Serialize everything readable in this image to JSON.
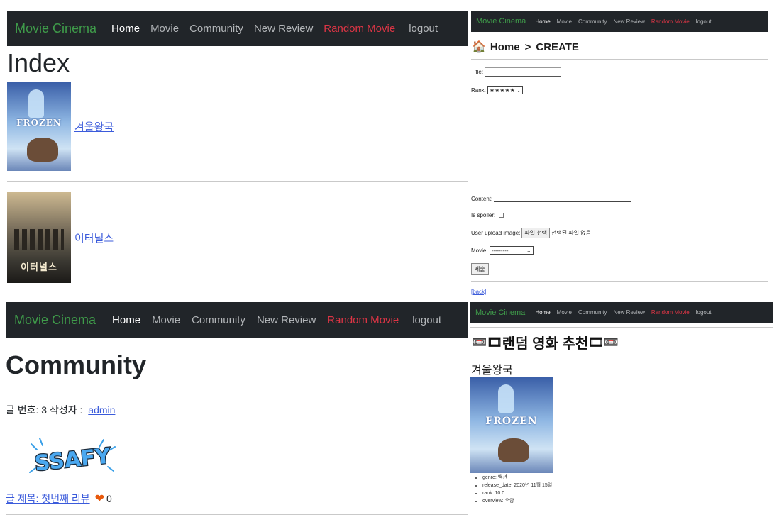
{
  "nav": {
    "brand": "Movie Cinema",
    "home": "Home",
    "movie": "Movie",
    "community": "Community",
    "new_review": "New Review",
    "random_movie": "Random Movie",
    "logout": "logout"
  },
  "index_page": {
    "title": "Index",
    "movies": [
      {
        "title": "겨울왕국",
        "poster_text": "FROZEN"
      },
      {
        "title": "이터널스",
        "poster_text": "이터널스"
      }
    ]
  },
  "create_page": {
    "breadcrumb": {
      "home_icon": "🏠",
      "home": "Home",
      "separator": ">",
      "current": "CREATE"
    },
    "labels": {
      "title": "Title:",
      "rank": "Rank:",
      "content": "Content:",
      "is_spoiler": "Is spoiler:",
      "user_upload_image": "User upload image:",
      "movie": "Movie:"
    },
    "rank_value": "★★★★★",
    "file_button": "파일 선택",
    "file_status": "선택된 파일 없음",
    "movie_select_value": "---------",
    "submit_button": "제출",
    "back_link": "[back]"
  },
  "community_page": {
    "title": "Community",
    "post_number_label": "글 번호: 3 작성자 :",
    "author": "admin",
    "logo_text": "SSAFY",
    "post_title_link": "글 제목: 첫번째 리뷰",
    "likes": "0"
  },
  "random_page": {
    "title_icons_left": "📼🎞",
    "title": "랜덤 영화 추천",
    "title_icons_right": "🎞📼",
    "movie_title": "겨울왕국",
    "poster_text": "FROZEN",
    "details": [
      "genre: 액션",
      "release_date: 2020년 11월 15일",
      "rank: 10.0",
      "overview: 우앙"
    ]
  },
  "colors": {
    "navbar_bg": "#212529",
    "brand": "#3f9c4a",
    "random_link": "#dc3545",
    "link": "#3b5bdb",
    "heart": "#e8590c"
  }
}
